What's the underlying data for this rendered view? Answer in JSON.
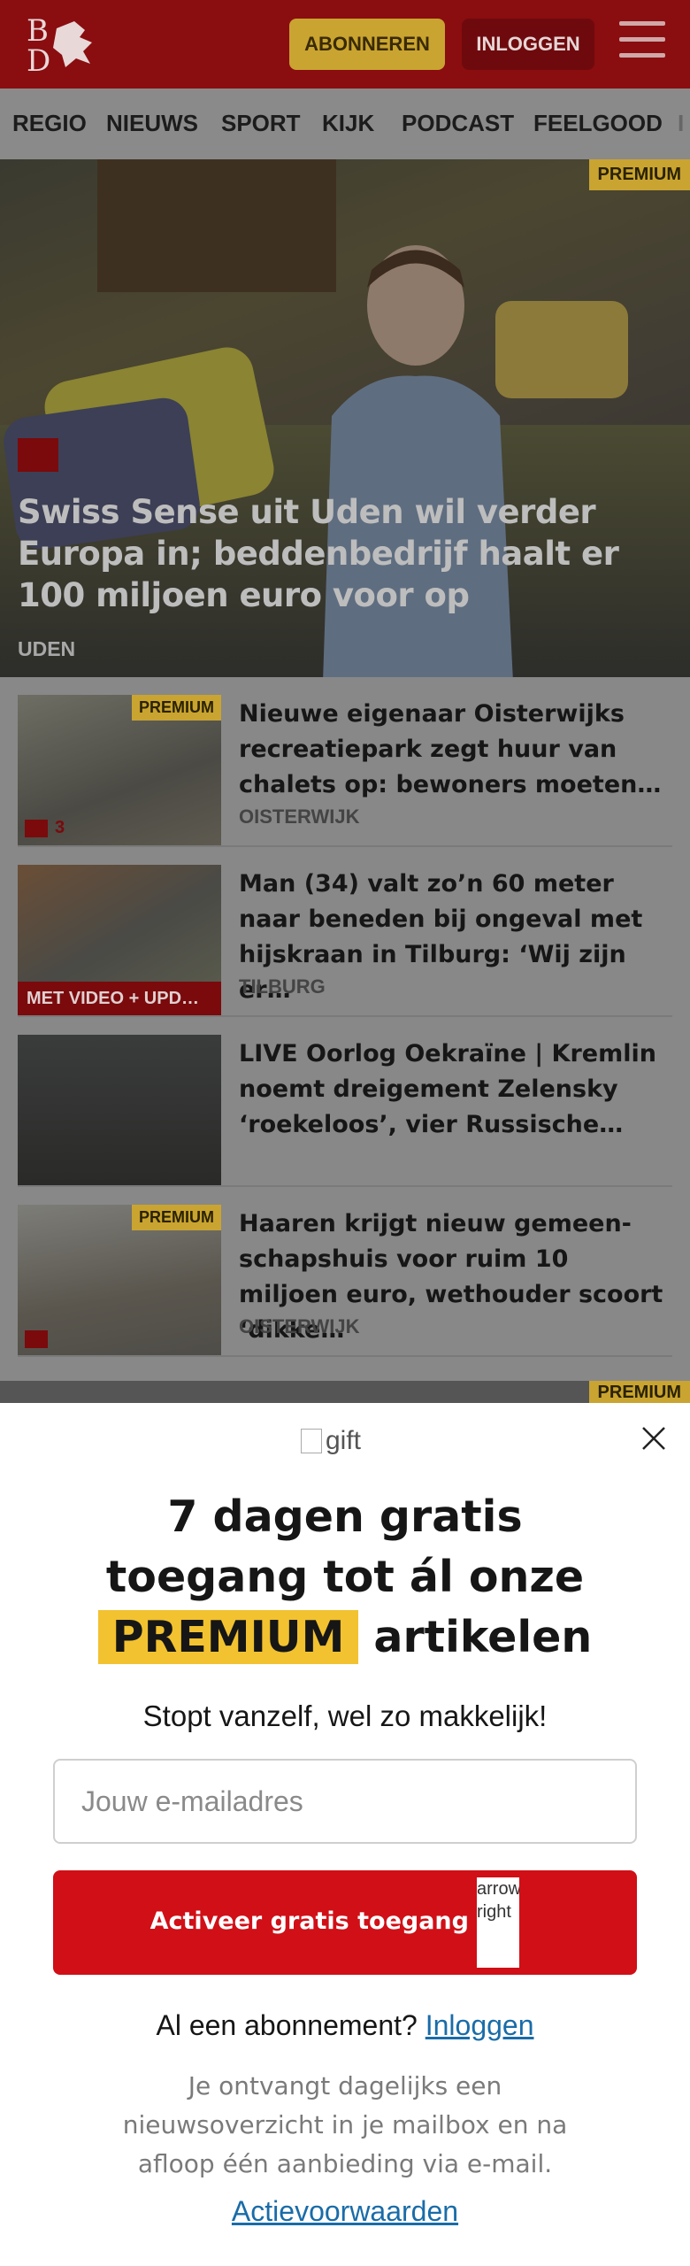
{
  "header": {
    "subscribe_label": "ABONNEREN",
    "login_label": "INLOGGEN",
    "brand_color": "#8a0d10"
  },
  "nav": {
    "items": [
      "REGIO",
      "NIEUWS",
      "SPORT",
      "KIJK",
      "PODCAST",
      "FEELGOOD",
      "I"
    ]
  },
  "hero": {
    "badge": "PREMIUM",
    "title": "Swiss Sense uit Uden wil verder Europa in; beddenbedrijf haalt er 100 miljoen euro voor op",
    "location": "UDEN"
  },
  "articles": [
    {
      "badge": "PREMIUM",
      "comments": "3",
      "title": "Nieuwe eigenaar Oisterwijks recreatiepark zegt huur van chalets op: bewoners moeten…",
      "location": "OISTERWIJK"
    },
    {
      "video_tag": "MET VIDEO + UPD…",
      "title": "Man (34) valt zo’n 60 meter naar beneden bij ongeval met hijskraan in Tilburg: ‘Wij zijn er…",
      "location": "TILBURG"
    },
    {
      "title": "LIVE Oorlog Oekraïne | Kremlin noemt dreigement Zelensky ‘roekeloos’, vier Russische…"
    },
    {
      "badge": "PREMIUM",
      "title": "Haaren krijgt nieuw gemeen-schapshuis voor ruim 10 miljoen euro, wethouder scoort ‘dikke…",
      "location": "OISTERWIJK"
    }
  ],
  "peek_badge": "PREMIUM",
  "modal": {
    "gift_alt": "gift",
    "title_line1": "7 dagen gratis",
    "title_line2": "toegang tot ál onze",
    "title_highlight": "PREMIUM",
    "title_line3_rest": " artikelen",
    "subtitle": "Stopt vanzelf, wel zo makkelijk!",
    "email_placeholder": "Jouw e-mailadres",
    "cta_label": "Activeer gratis toegang",
    "cta_icon_alt": "arrow-right",
    "already_text": "Al een abonnement?",
    "already_link": "Inloggen",
    "info": "Je ontvangt dagelijks een nieuwsoverzicht in je mailbox en na afloop één aanbieding via e-mail.",
    "terms_link": "Actievoorwaarden",
    "cta_color": "#d00f17",
    "highlight_color": "#f2c230",
    "link_color": "#1a6ca8"
  }
}
